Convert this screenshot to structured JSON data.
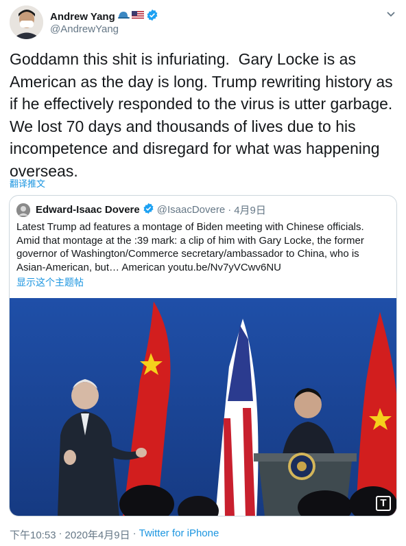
{
  "author": {
    "name": "Andrew Yang",
    "handle": "@AndrewYang",
    "name_emoji_cap": "blue-cap",
    "name_emoji_flag": "us-flag",
    "verified": true
  },
  "tweet": {
    "text": "Goddamn this shit is infuriating.  Gary Locke is as American as the day is long. Trump rewriting history as if he effectively responded to the virus is utter garbage. We lost 70 days and thousands of lives due to his incompetence and disregard for what was happening overseas.",
    "translate_label": "翻译推文"
  },
  "quoted": {
    "name": "Edward-Isaac Dovere",
    "handle": "@IsaacDovere",
    "separator": "·",
    "date": "4月9日",
    "text": "Latest Trump ad features a montage of Biden meeting with Chinese officials. Amid that montage at the :39 mark: a clip of him with Gary Locke, the former governor of Washington/Commerce secretary/ambassador to China, who is Asian-American, but… American youtu.be/Nv7yVCwv6NU",
    "show_thread": "显示这个主题帖",
    "media_badge": "T"
  },
  "footer": {
    "time": "下午10:53",
    "dot": "·",
    "date": "2020年4月9日",
    "dot2": "·",
    "source": "Twitter for iPhone"
  },
  "colors": {
    "accent": "#1b95e0",
    "verified": "#1da1f2",
    "muted": "#657786"
  }
}
